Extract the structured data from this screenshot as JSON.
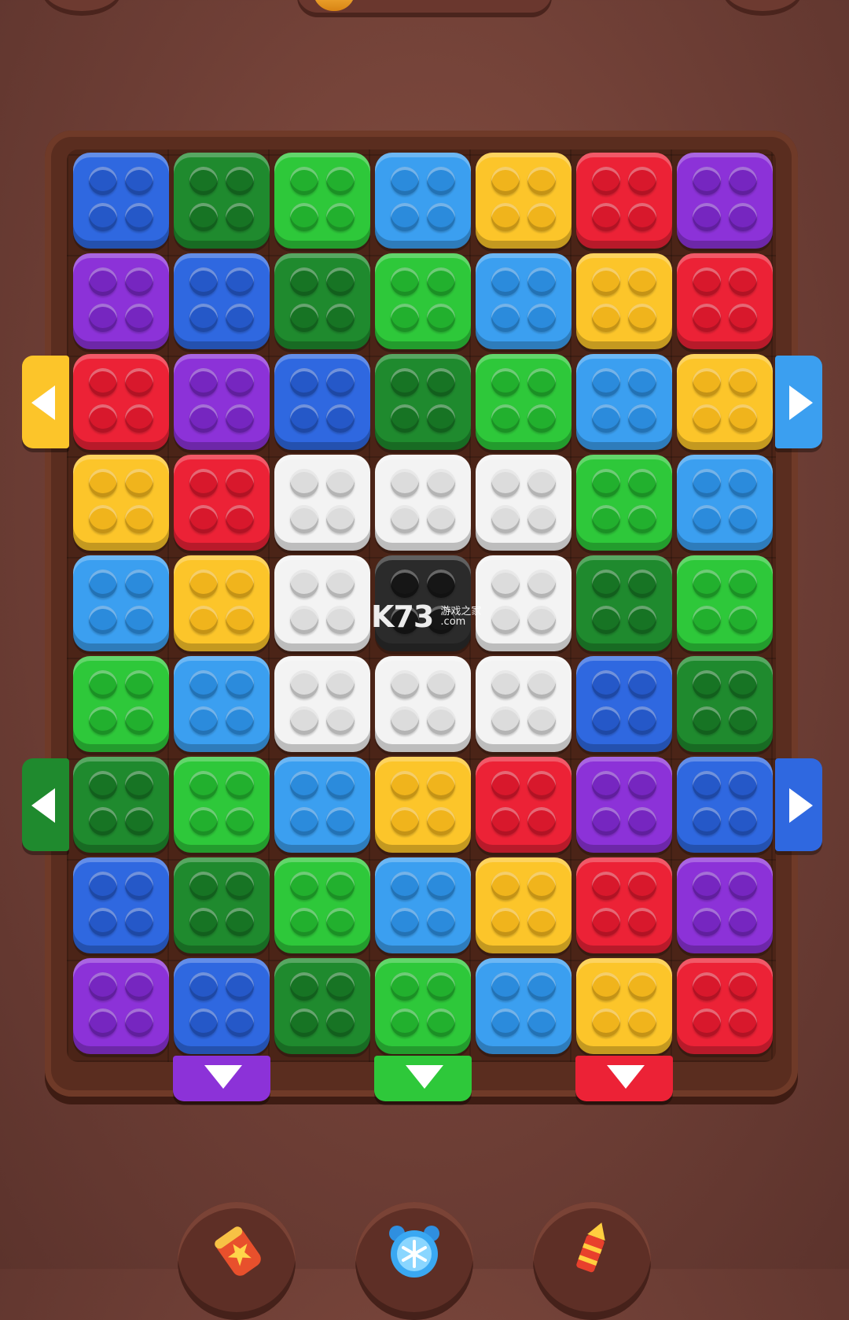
{
  "colors": {
    "blue": "#2f68e0",
    "darkgreen": "#1f8a2e",
    "green": "#2ec83a",
    "lightblue": "#3b9ff0",
    "yellow": "#fcc52a",
    "red": "#ec2236",
    "purple": "#8c32d8",
    "white": "#f3f3f3",
    "black": "#2b2b2b"
  },
  "grid": [
    [
      "blue",
      "darkgreen",
      "green",
      "lightblue",
      "yellow",
      "red",
      "purple"
    ],
    [
      "purple",
      "blue",
      "darkgreen",
      "green",
      "lightblue",
      "yellow",
      "red"
    ],
    [
      "red",
      "purple",
      "blue",
      "darkgreen",
      "green",
      "lightblue",
      "yellow"
    ],
    [
      "yellow",
      "red",
      "white",
      "white",
      "white",
      "green",
      "lightblue"
    ],
    [
      "lightblue",
      "yellow",
      "white",
      "black",
      "white",
      "darkgreen",
      "green"
    ],
    [
      "green",
      "lightblue",
      "white",
      "white",
      "white",
      "blue",
      "darkgreen"
    ],
    [
      "darkgreen",
      "green",
      "lightblue",
      "yellow",
      "red",
      "purple",
      "blue"
    ],
    [
      "blue",
      "darkgreen",
      "green",
      "lightblue",
      "yellow",
      "red",
      "purple"
    ],
    [
      "purple",
      "blue",
      "darkgreen",
      "green",
      "lightblue",
      "yellow",
      "red"
    ]
  ],
  "shooters": [
    {
      "side": "left",
      "row": 2,
      "color": "yellow"
    },
    {
      "side": "right",
      "row": 2,
      "color": "lightblue"
    },
    {
      "side": "left",
      "row": 6,
      "color": "darkgreen"
    },
    {
      "side": "right",
      "row": 6,
      "color": "blue"
    },
    {
      "side": "bottom",
      "col": 1,
      "color": "purple"
    },
    {
      "side": "bottom",
      "col": 3,
      "color": "green"
    },
    {
      "side": "bottom",
      "col": 5,
      "color": "red"
    }
  ],
  "boosters": [
    {
      "icon": "firecracker-icon"
    },
    {
      "icon": "freeze-clock-icon"
    },
    {
      "icon": "rocket-icon"
    }
  ],
  "watermark": {
    "main": "K73",
    "cn": "游戏之家",
    "domain": ".com"
  }
}
